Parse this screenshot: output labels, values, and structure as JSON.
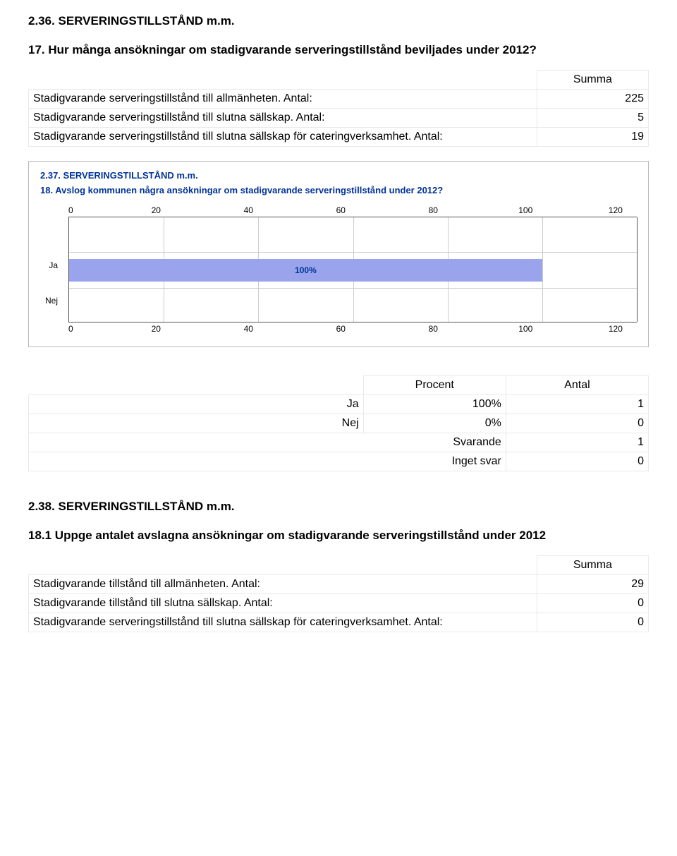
{
  "section36": {
    "heading": "2.36. SERVERINGSTILLSTÅND m.m.",
    "question": "17. Hur många ansökningar om stadigvarande serveringstillstånd beviljades under 2012?",
    "summa_label": "Summa",
    "rows": [
      {
        "label": "Stadigvarande serveringstillstånd till allmänheten. Antal:",
        "value": "225"
      },
      {
        "label": "Stadigvarande serveringstillstånd till slutna sällskap. Antal:",
        "value": "5"
      },
      {
        "label": "Stadigvarande serveringstillstånd till slutna sällskap för cateringverksamhet. Antal:",
        "value": "19"
      }
    ]
  },
  "chart": {
    "heading": "2.37. SERVERINGSTILLSTÅND m.m.",
    "question": "18. Avslog kommunen några ansökningar om stadigvarande serveringstillstånd under 2012?",
    "ticks": [
      "0",
      "20",
      "40",
      "60",
      "80",
      "100",
      "120"
    ],
    "cat_ja": "Ja",
    "cat_nej": "Nej",
    "bar_label": "100%"
  },
  "pct_table": {
    "head_pct": "Procent",
    "head_ant": "Antal",
    "rows": [
      {
        "label": "Ja",
        "pct": "100%",
        "ant": "1"
      },
      {
        "label": "Nej",
        "pct": "0%",
        "ant": "0"
      }
    ],
    "summary": [
      {
        "label": "Svarande",
        "val": "1"
      },
      {
        "label": "Inget svar",
        "val": "0"
      }
    ]
  },
  "section38": {
    "heading": "2.38. SERVERINGSTILLSTÅND m.m.",
    "question": "18.1 Uppge antalet avslagna ansökningar om stadigvarande serveringstillstånd under 2012",
    "summa_label": "Summa",
    "rows": [
      {
        "label": "Stadigvarande tillstånd till allmänheten. Antal:",
        "value": "29"
      },
      {
        "label": "Stadigvarande tillstånd till slutna sällskap. Antal:",
        "value": "0"
      },
      {
        "label": "Stadigvarande serveringstillstånd till slutna sällskap för cateringverksamhet. Antal:",
        "value": "0"
      }
    ]
  },
  "chart_data": {
    "type": "bar",
    "orientation": "horizontal",
    "categories": [
      "Ja",
      "Nej"
    ],
    "values": [
      100,
      0
    ],
    "unit": "percent",
    "title": "18. Avslog kommunen några ansökningar om stadigvarande serveringstillstånd under 2012?",
    "xlabel": "",
    "ylabel": "",
    "xlim": [
      0,
      120
    ],
    "xticks": [
      0,
      20,
      40,
      60,
      80,
      100,
      120
    ]
  }
}
